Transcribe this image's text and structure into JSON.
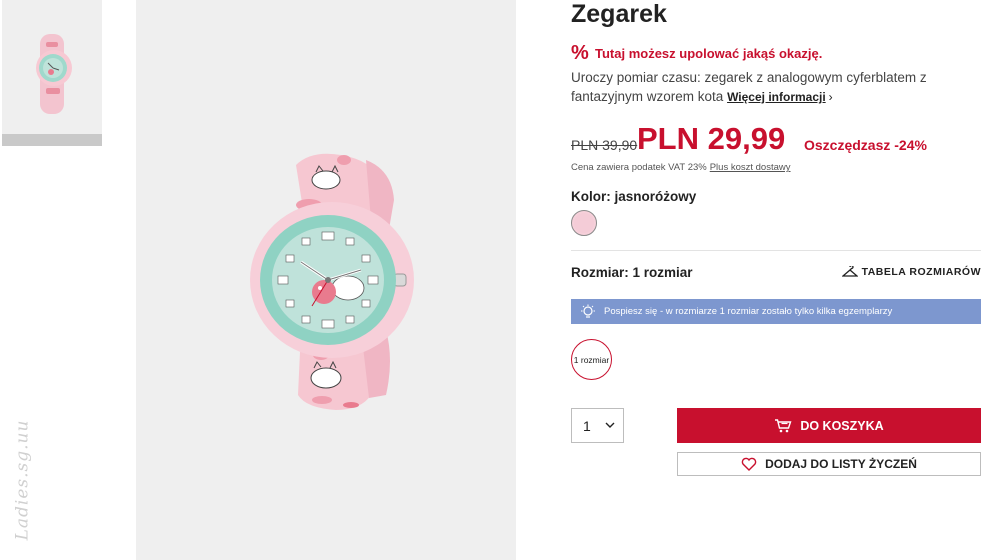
{
  "gallery": {
    "watermark": "Ladies.sg.uu"
  },
  "product": {
    "title": "Zegarek",
    "promo_icon": "%",
    "promo_text": "Tutaj możesz upolować jakąś okazję.",
    "description": "Uroczy pomiar czasu: zegarek z analogowym cyferblatem z fantazyjnym wzorem kota",
    "more_link": "Więcej informacji",
    "more_chevron": "›"
  },
  "price": {
    "old": "PLN 39,90",
    "current": "PLN 29,99",
    "savings": "Oszczędzasz -24%",
    "tax_note": "Cena zawiera podatek VAT 23%",
    "shipping_link": "Plus koszt dostawy"
  },
  "color": {
    "label": "Kolor: jasnoróżowy",
    "swatch_hex": "#f4ccd7"
  },
  "size": {
    "label": "Rozmiar: 1 rozmiar",
    "table_link": "TABELA ROZMIARÓW",
    "alert_text": "Pospiesz się - w rozmiarze 1 rozmiar zostało tylko kilka egzemplarzy",
    "option": "1 rozmiar"
  },
  "purchase": {
    "quantity": "1",
    "add_to_cart": "DO KOSZYKA",
    "add_to_wishlist": "DODAJ DO LISTY ŻYCZEŃ"
  },
  "colors": {
    "accent": "#c8102e",
    "alert_bg": "#7d97cf",
    "image_bg": "#efefef"
  },
  "icons": [
    "percent-icon",
    "chevron-right-icon",
    "hanger-icon",
    "lightbulb-icon",
    "chevron-down-icon",
    "cart-icon",
    "heart-icon"
  ]
}
